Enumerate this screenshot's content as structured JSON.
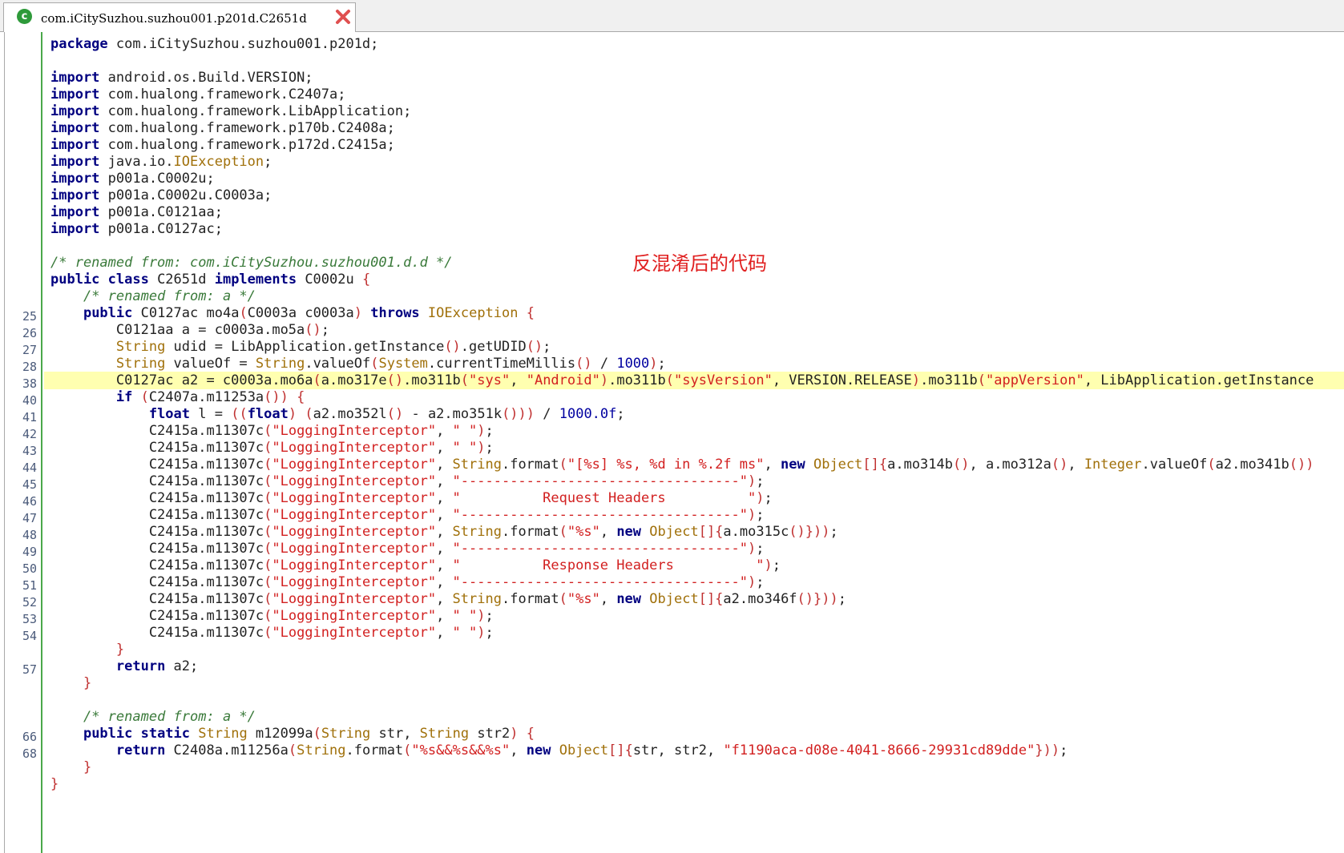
{
  "tab": {
    "title": "com.iCitySuzhou.suzhou001.p201d.C2651d"
  },
  "annotation": "反混淆后的代码",
  "gutter_numbers": [
    "25",
    "26",
    "27",
    "28",
    "38",
    "40",
    "41",
    "42",
    "43",
    "44",
    "45",
    "46",
    "47",
    "48",
    "49",
    "50",
    "51",
    "52",
    "53",
    "54",
    "57",
    "66",
    "68"
  ],
  "code": {
    "package_line": "package com.iCitySuzhou.suzhou001.p201d;",
    "imports": [
      "android.os.Build.VERSION;",
      "com.hualong.framework.C2407a;",
      "com.hualong.framework.LibApplication;",
      "com.hualong.framework.p170b.C2408a;",
      "com.hualong.framework.p172d.C2415a;",
      "java.io.IOException;",
      "p001a.C0002u;",
      "p001a.C0002u.C0003a;",
      "p001a.C0121aa;",
      "p001a.C0127ac;"
    ],
    "comment_class": "/* renamed from: com.iCitySuzhou.suzhou001.d.d */",
    "comment_method": "/* renamed from: a */",
    "log_tag": "\"LoggingInterceptor\"",
    "strings": {
      "sys": "\"sys\"",
      "android": "\"Android\"",
      "sysVersion": "\"sysVersion\"",
      "appVersion": "\"appVersion\"",
      "fmt_request": "\"[%s] %s, %d in %.2f ms\"",
      "dashes": "\"----------------------------------\"",
      "request_headers": "\"          Request Headers          \"",
      "response_headers": "\"          Response Headers          \"",
      "fmt_s": "\"%s\"",
      "space": "\" \"",
      "fmt_sig": "\"%s&&%s&&%s\"",
      "secret": "\"f1190aca-d08e-4041-8666-29931cd89dde\""
    }
  }
}
